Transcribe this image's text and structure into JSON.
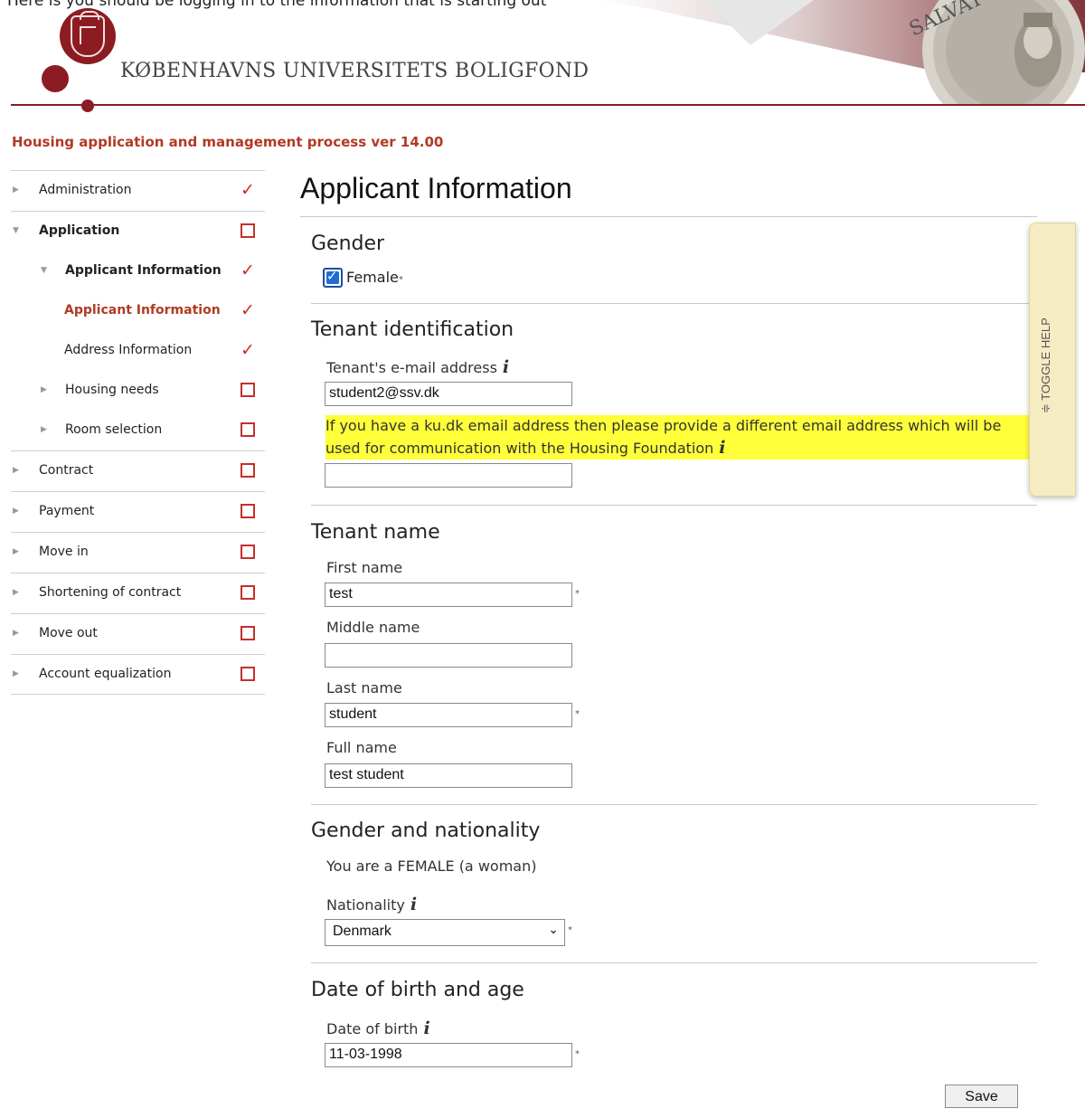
{
  "top_cut_text": "Here is you should be logging in to the information that is starting out",
  "header": {
    "brand": "KØBENHAVNS UNIVERSITETS BOLIGFOND",
    "seal_text": "SALVAT",
    "accent_color": "#8c1c22"
  },
  "process_title": "Housing application and management process ver 14.00",
  "sidebar": {
    "items": [
      {
        "label": "Administration",
        "status": "done"
      },
      {
        "label": "Application",
        "status": "open"
      },
      {
        "label": "Applicant Information",
        "status": "done"
      },
      {
        "label": "Applicant Information",
        "status": "done"
      },
      {
        "label": "Address Information",
        "status": "done"
      },
      {
        "label": "Housing needs",
        "status": "open"
      },
      {
        "label": "Room selection",
        "status": "open"
      },
      {
        "label": "Contract",
        "status": "open"
      },
      {
        "label": "Payment",
        "status": "open"
      },
      {
        "label": "Move in",
        "status": "open"
      },
      {
        "label": "Shortening of contract",
        "status": "open"
      },
      {
        "label": "Move out",
        "status": "open"
      },
      {
        "label": "Account equalization",
        "status": "open"
      }
    ]
  },
  "main": {
    "title": "Applicant Information",
    "gender": {
      "title": "Gender",
      "option": "Female",
      "checked": true
    },
    "tenant_identification": {
      "title": "Tenant identification",
      "email_label": "Tenant's e-mail address",
      "email_value": "student2@ssv.dk",
      "alt_email_note": "If you have a ku.dk email address then please provide a different email address which will be used for communication with the Housing Foundation",
      "alt_email_value": ""
    },
    "tenant_name": {
      "title": "Tenant name",
      "first_label": "First name",
      "first_value": "test",
      "middle_label": "Middle name",
      "middle_value": "",
      "last_label": "Last name",
      "last_value": "student",
      "full_label": "Full name",
      "full_value": "test  student"
    },
    "gender_nationality": {
      "title": "Gender and nationality",
      "gender_text": "You are a FEMALE (a woman)",
      "nationality_label": "Nationality",
      "nationality_value": "Denmark"
    },
    "dob": {
      "title": "Date of birth and age",
      "label": "Date of birth",
      "value": "11-03-1998"
    },
    "save_label": "Save"
  },
  "toggle_help": "≑ TOGGLE HELP",
  "symbols": {
    "check": "✓",
    "info": "i",
    "required": "*",
    "arrow_right": "▶",
    "arrow_down": "▼",
    "chevron": "⌄"
  }
}
